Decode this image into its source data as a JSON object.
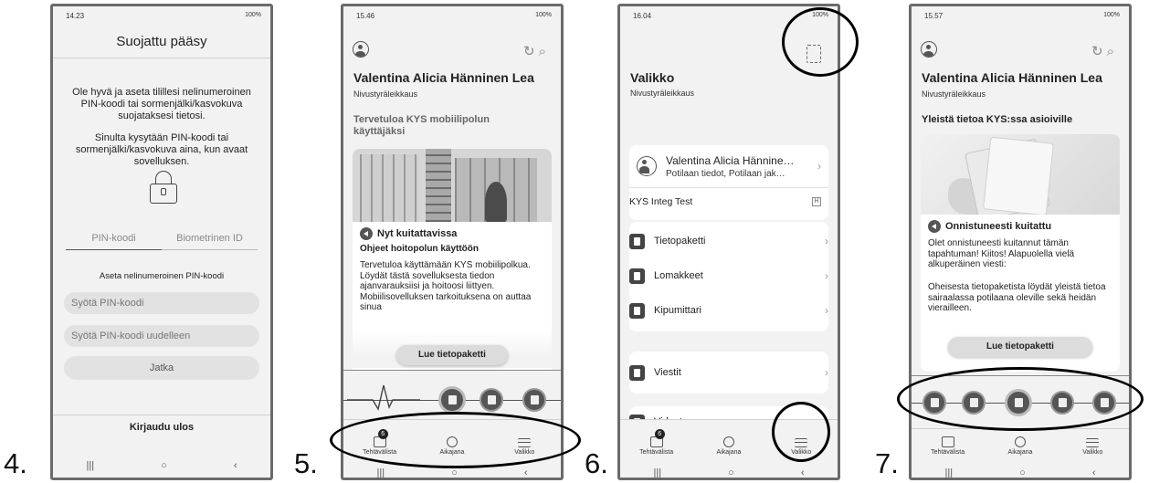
{
  "steps": [
    "4.",
    "5.",
    "6.",
    "7."
  ],
  "status": {
    "s4_time": "14.23",
    "s5_time": "15.46",
    "s6_time": "16.04",
    "s7_time": "15.57",
    "battery": "100%"
  },
  "screen4": {
    "title": "Suojattu pääsy",
    "para1": "Ole hyvä ja aseta tilillesi nelinumeroinen PIN-koodi tai sormenjälki/kasvokuva suojataksesi tietosi.",
    "para2": "Sinulta kysytään PIN-koodi tai sormenjälki/kasvokuva aina, kun avaat sovelluksen.",
    "tab_pin": "PIN-koodi",
    "tab_bio": "Biometrinen ID",
    "set_pin_label": "Aseta nelinumeroinen PIN-koodi",
    "pin_placeholder": "Syötä PIN-koodi",
    "pin_again_placeholder": "Syötä PIN-koodi uudelleen",
    "continue": "Jatka",
    "logout": "Kirjaudu ulos"
  },
  "patient": {
    "name": "Valentina Alicia Hänninen Lea",
    "procedure": "Nivustyräleikkaus"
  },
  "screen5": {
    "section": "Tervetuloa KYS mobiilipolun käyttäjäksi",
    "card_head": "Nyt kuitattavissa",
    "card_subhead": "Ohjeet hoitopolun käyttöön",
    "card_text": "Tervetuloa käyttämään KYS mobiilipolkua. Löydät tästä sovelluksesta tiedon ajanvarauksiisi ja hoitoosi liittyen. Mobiilisovelluksen tarkoituksena on auttaa sinua",
    "button": "Lue tietopaketti"
  },
  "tabs": {
    "tasks": "Tehtävälista",
    "timeline": "Aikajana",
    "menu": "Valikko",
    "tasks_badge": "6"
  },
  "screen6": {
    "title": "Valikko",
    "subtitle": "Nivustyräleikkaus",
    "profile_name": "Valentina Alicia Hännine…",
    "profile_sub": "Potilaan tiedot, Potilaan jak…",
    "env": "KYS Integ Test",
    "items": [
      "Tietopaketti",
      "Lomakkeet",
      "Kipumittari",
      "Viestit",
      "Videot"
    ]
  },
  "screen7": {
    "section": "Yleistä tietoa KYS:ssa asioiville",
    "card_head": "Onnistuneesti kuitattu",
    "card_text1": "Olet onnistuneesti kuitannut tämän tapahtuman! Kiitos! Alapuolella vielä alkuperäinen viesti:",
    "card_text2": "Oheisesta tietopaketista löydät yleistä tietoa sairaalassa potilaana oleville sekä heidän vierailleen.",
    "button": "Lue tietopaketti"
  },
  "icons": [
    "avatar-icon",
    "refresh-icon",
    "search-icon",
    "qr-icon",
    "lock-icon",
    "speaker-icon",
    "chevron-right-icon"
  ]
}
